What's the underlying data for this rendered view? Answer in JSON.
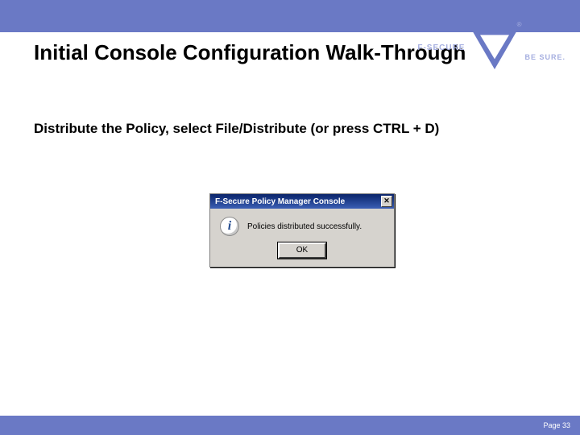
{
  "header": {
    "title": "Initial Console Configuration Walk-Through",
    "brand": "F-SECURE",
    "registered": "®",
    "tagline": "BE SURE."
  },
  "body": {
    "instruction": "Distribute the Policy, select File/Distribute (or press CTRL + D)"
  },
  "dialog": {
    "title": "F-Secure Policy Manager Console",
    "close_glyph": "✕",
    "info_glyph": "i",
    "message": "Policies distributed successfully.",
    "ok_label": "OK"
  },
  "footer": {
    "page_label": "Page 33"
  }
}
